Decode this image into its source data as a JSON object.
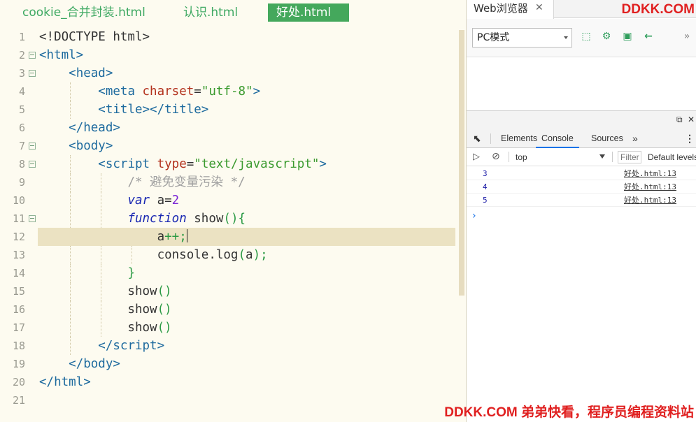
{
  "editor": {
    "tabs": [
      {
        "label": "cookie_合并封装.html",
        "active": false
      },
      {
        "label": "认识.html",
        "active": false
      },
      {
        "label": "好处.html",
        "active": true
      }
    ],
    "current_line": 12
  },
  "browser": {
    "tab_label": "Web浏览器",
    "brand": "DDKK.COM",
    "mode": "PC模式",
    "devtools": {
      "tabs": [
        "Elements",
        "Console",
        "Sources",
        "»"
      ],
      "active_tab": "Console",
      "context": "top",
      "filter_placeholder": "Filter",
      "levels": "Default levels",
      "logs": [
        {
          "value": "3",
          "source": "好处.html:13"
        },
        {
          "value": "4",
          "source": "好处.html:13"
        },
        {
          "value": "5",
          "source": "好处.html:13"
        }
      ],
      "prompt": "›"
    }
  },
  "watermark": "DDKK.COM 弟弟快看，程序员编程资料站",
  "colors": {
    "accent": "#44a85c",
    "brand": "#e02020"
  }
}
